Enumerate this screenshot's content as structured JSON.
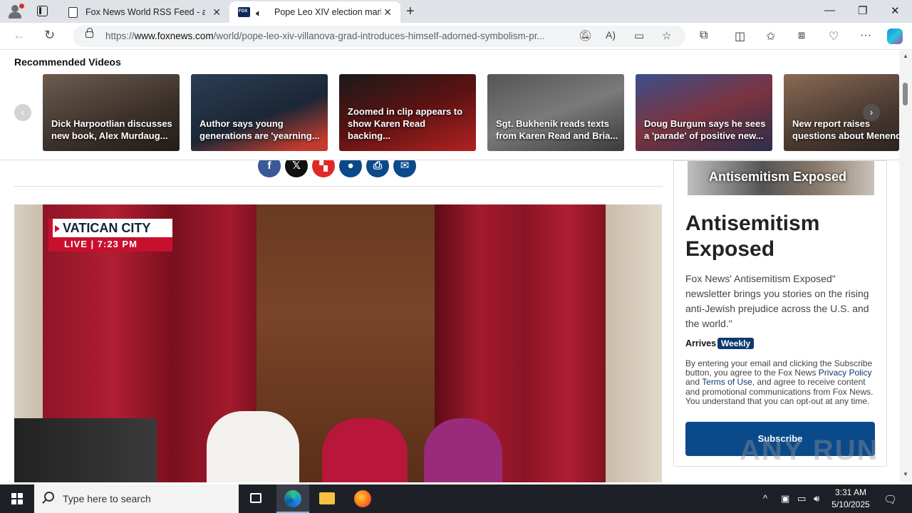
{
  "browser": {
    "tabs": [
      {
        "title": "Fox News World RSS Feed - albert"
      },
      {
        "title": "Pope Leo XIV election mark"
      }
    ],
    "url_prefix": "https://",
    "url_domain": "www.foxnews.com",
    "url_path": "/world/pope-leo-xiv-villanova-grad-introduces-himself-adorned-symbolism-pr..."
  },
  "recommended": {
    "title": "Recommended Videos",
    "videos": [
      {
        "caption": "Dick Harpootlian discusses new book, Alex Murdaug..."
      },
      {
        "caption": "Author says young generations are 'yearning..."
      },
      {
        "caption": "Zoomed in clip appears to show Karen Read backing..."
      },
      {
        "caption": "Sgt. Bukhenik reads texts from Karen Read and Bria..."
      },
      {
        "caption": "Doug Burgum says he sees a 'parade' of positive new..."
      },
      {
        "caption": "New report raises questions about Menend"
      }
    ]
  },
  "video": {
    "location": "VATICAN CITY",
    "live_label": "LIVE",
    "time": "7:23 PM"
  },
  "sidebar": {
    "banner_text": "Antisemitism Exposed",
    "title": "Antisemitism Exposed",
    "description": "Fox News' Antisemitism Exposed\" newsletter brings you stories on the rising anti-Jewish prejudice across the U.S. and the world.\"",
    "arrives_label": "Arrives",
    "frequency": "Weekly",
    "legal_1": "By entering your email and clicking the Subscribe button, you agree to the Fox News ",
    "privacy_link": "Privacy Policy",
    "legal_and": " and ",
    "terms_link": "Terms of Use",
    "legal_2": ", and agree to receive content and promotional communications from Fox News. You understand that you can opt-out at any time.",
    "subscribe_label": "Subscribe"
  },
  "watermark": "ANY RUN",
  "taskbar": {
    "search_placeholder": "Type here to search",
    "time": "3:31 AM",
    "date": "5/10/2025"
  }
}
